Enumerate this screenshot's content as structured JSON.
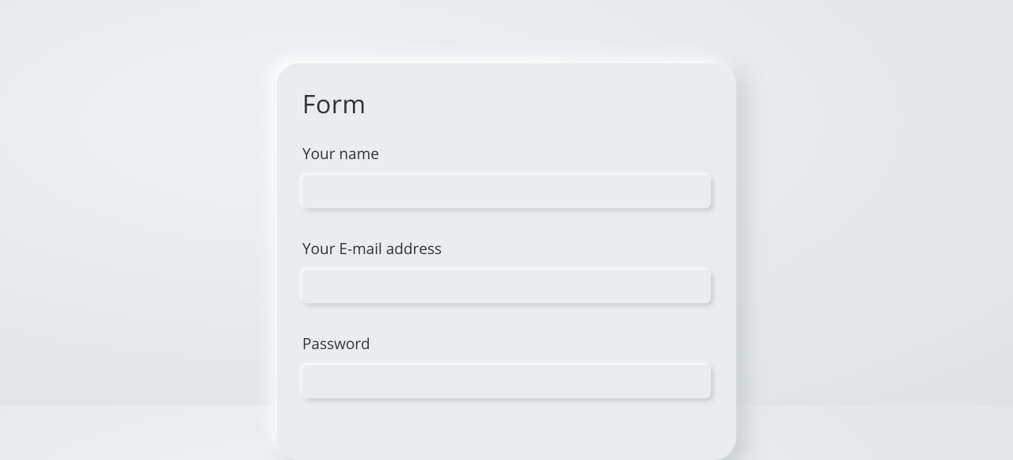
{
  "form": {
    "title": "Form",
    "fields": {
      "name": {
        "label": "Your name",
        "value": ""
      },
      "email": {
        "label": "Your E-mail address",
        "value": ""
      },
      "password": {
        "label": "Password",
        "value": ""
      }
    }
  }
}
